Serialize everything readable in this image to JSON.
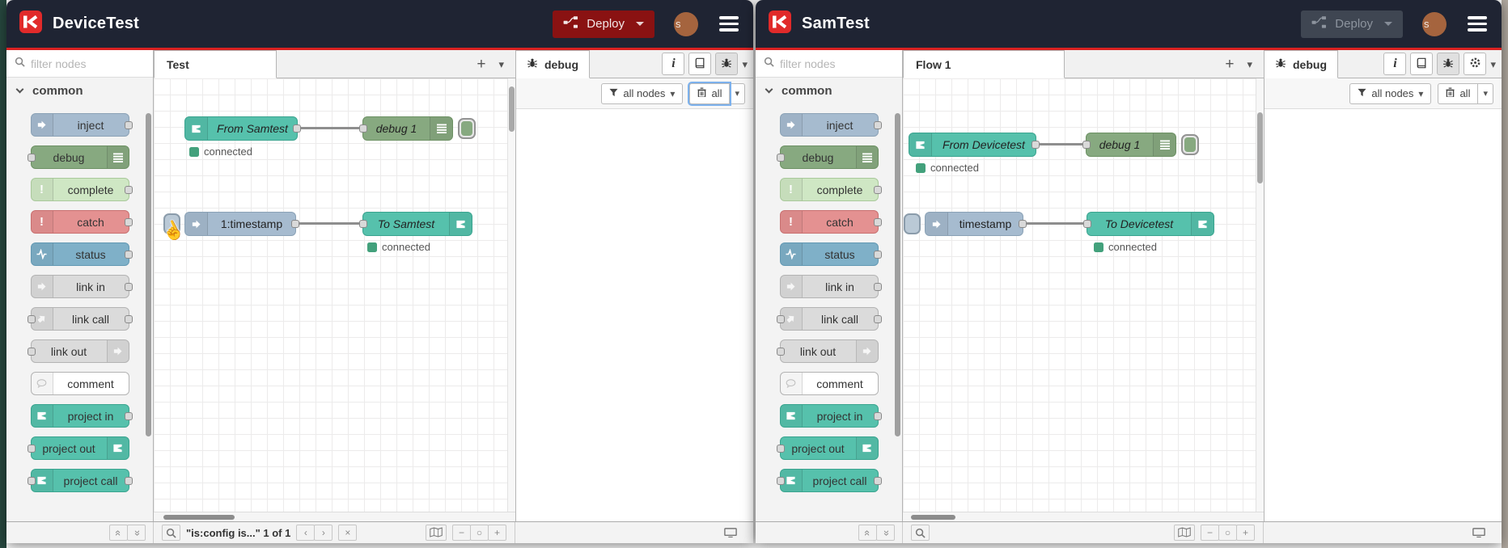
{
  "glyphs": {
    "caret": "▾",
    "plus": "+",
    "minus": "−",
    "zoom_reset": "○",
    "up": "«",
    "down": "«",
    "prev": "‹",
    "next": "›",
    "close": "×",
    "info": "i",
    "exclaim": "!",
    "cursor": "☝"
  },
  "shared": {
    "deploy_label": "Deploy",
    "filter_placeholder": "filter nodes",
    "palette_category": "common",
    "palette_items": [
      "inject",
      "debug",
      "complete",
      "catch",
      "status",
      "link in",
      "link call",
      "link out",
      "comment",
      "project in",
      "project out",
      "project call"
    ],
    "debug_tab_label": "debug",
    "filter_all_nodes": "all nodes",
    "clear_all": "all",
    "connected": "connected"
  },
  "left": {
    "title": "DeviceTest",
    "avatar_letter": "s",
    "tab_label": "Test",
    "nodes": {
      "from": "From Samtest",
      "debug": "debug 1",
      "inject": "1:timestamp",
      "to": "To Samtest"
    },
    "footer_search_text": "\"is:config is...\" 1 of 1"
  },
  "right": {
    "title": "SamTest",
    "avatar_letter": "s",
    "tab_label": "Flow 1",
    "nodes": {
      "from": "From Devicetest",
      "debug": "debug 1",
      "inject": "timestamp",
      "to": "To Devicetest"
    }
  },
  "colors": {
    "header_bg": "#1f2433",
    "header_accent": "#d92121",
    "deploy_enabled_bg": "#8a1212",
    "deploy_disabled_bg": "#3f4652",
    "node_teal": "#56c1ac",
    "node_inject": "#a6bbcf",
    "node_debug": "#87a980",
    "node_complete": "#cfe7c4",
    "node_catch": "#e49191",
    "node_status": "#7fb0c8",
    "node_link": "#dbdbdb",
    "status_connected_dot": "#43a17c"
  }
}
